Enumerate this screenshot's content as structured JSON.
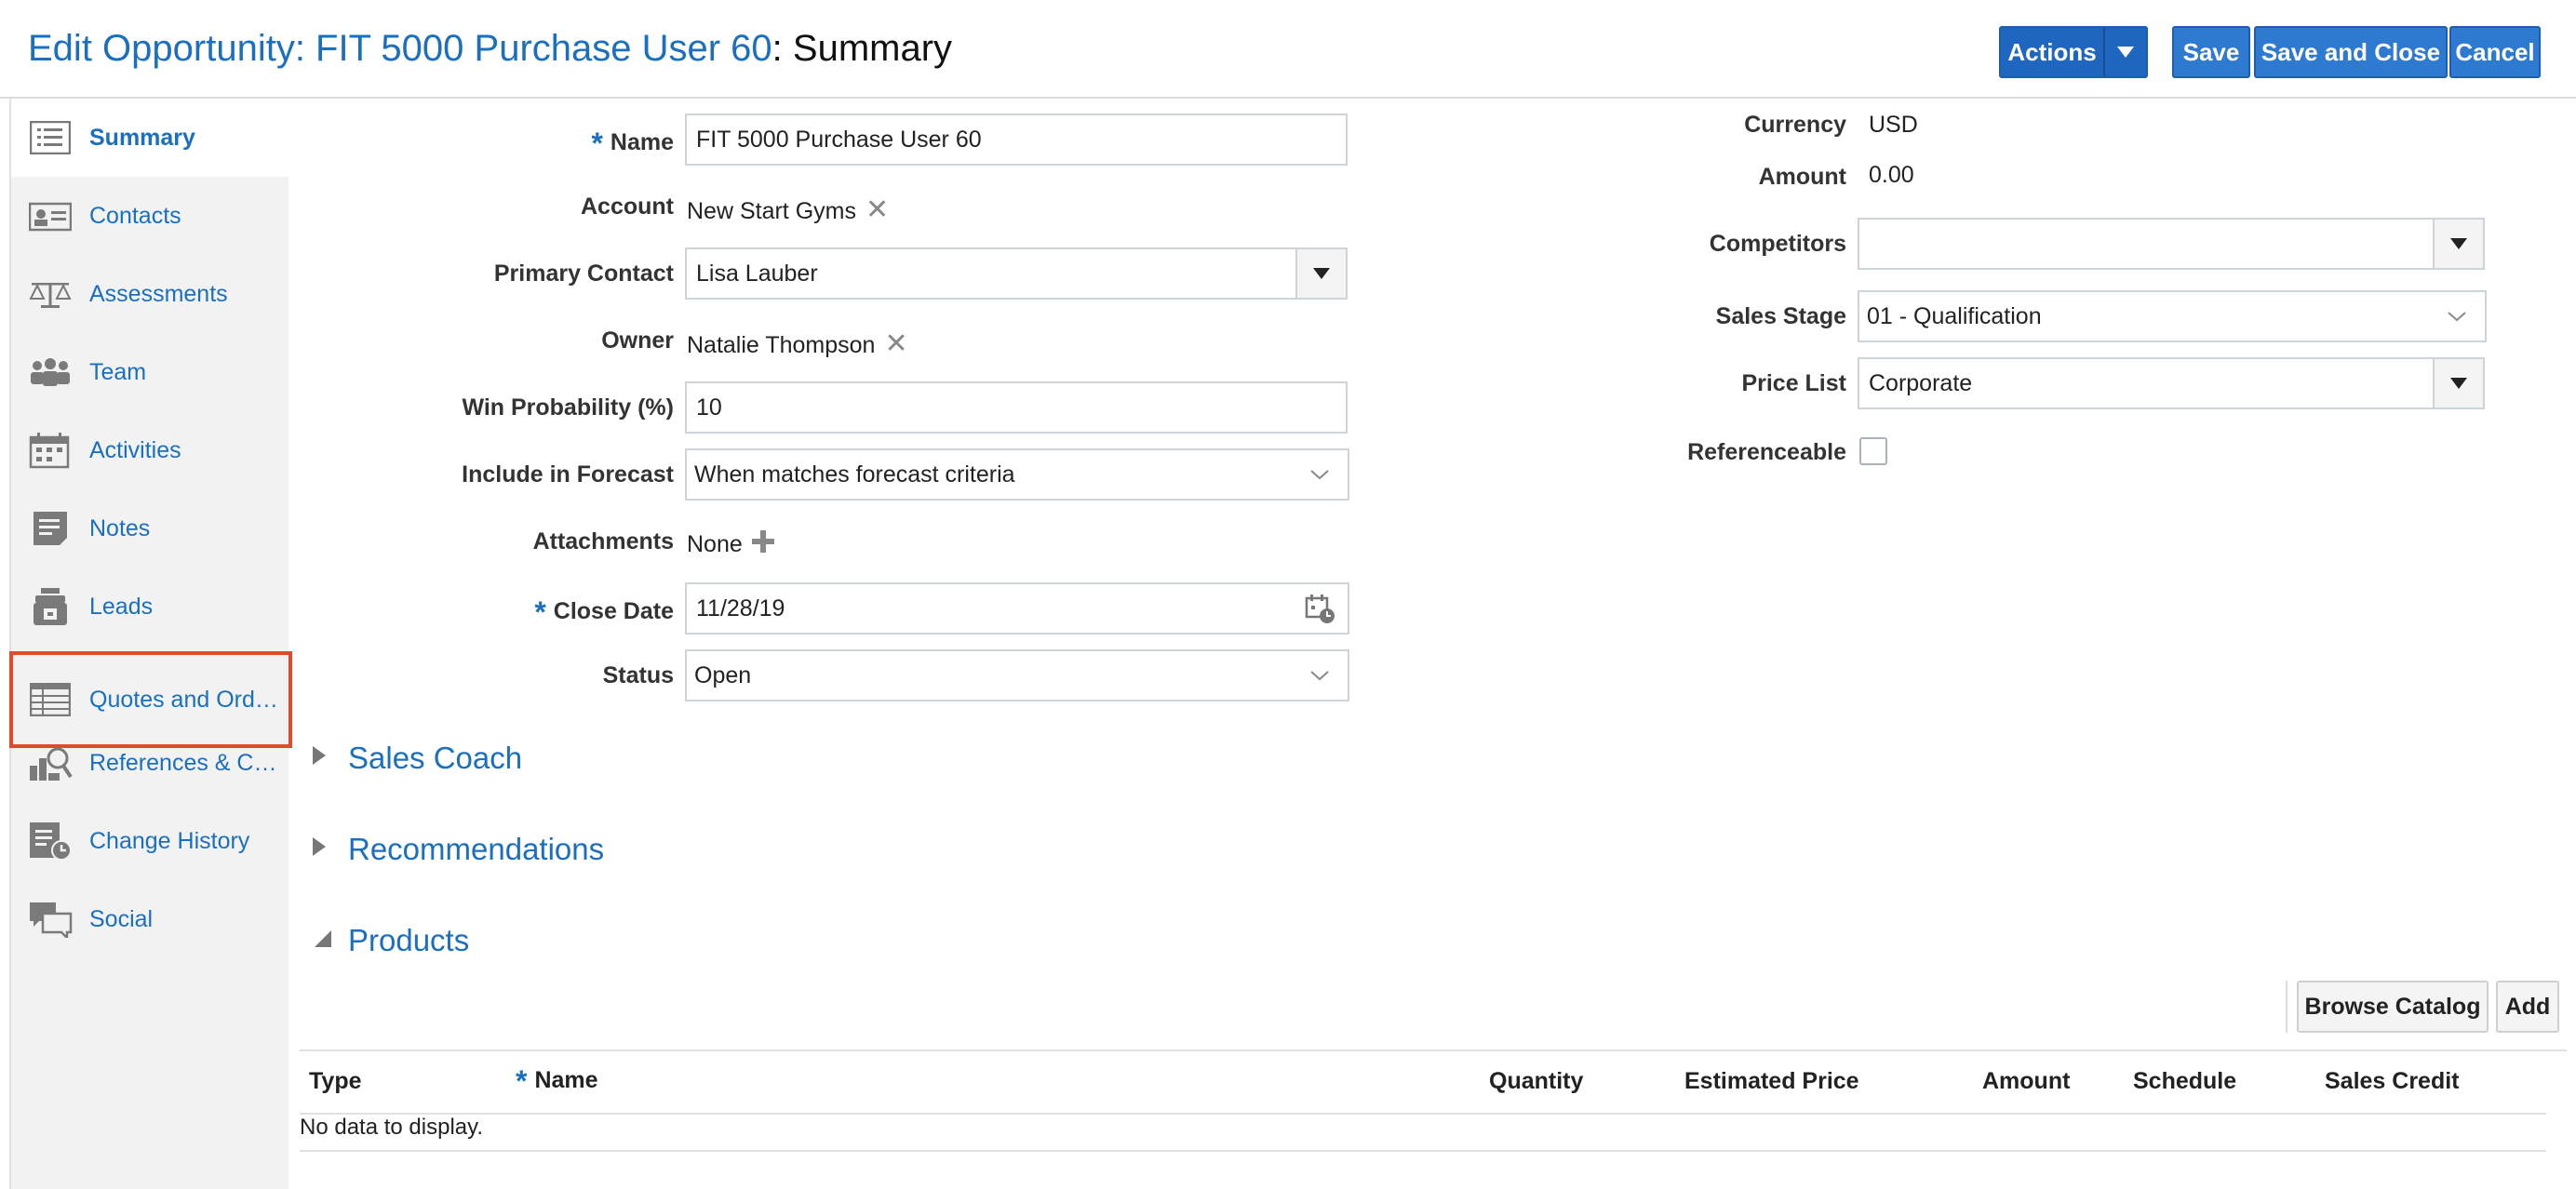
{
  "header": {
    "title_prefix": "Edit Opportunity: FIT 5000 Purchase User 60",
    "title_suffix": ": Summary",
    "actions_label": "Actions",
    "save_label": "Save",
    "save_close_label": "Save and Close",
    "cancel_label": "Cancel"
  },
  "sidebar": {
    "items": [
      {
        "label": "Summary",
        "icon": "summary-list-icon"
      },
      {
        "label": "Contacts",
        "icon": "contacts-card-icon"
      },
      {
        "label": "Assessments",
        "icon": "scales-icon"
      },
      {
        "label": "Team",
        "icon": "team-people-icon"
      },
      {
        "label": "Activities",
        "icon": "calendar-activities-icon"
      },
      {
        "label": "Notes",
        "icon": "notes-icon"
      },
      {
        "label": "Leads",
        "icon": "leads-icon"
      },
      {
        "label": "Quotes and Ord…",
        "icon": "quotes-grid-icon"
      },
      {
        "label": "References & C…",
        "icon": "references-search-icon"
      },
      {
        "label": "Change History",
        "icon": "change-history-icon"
      },
      {
        "label": "Social",
        "icon": "social-chat-icon"
      }
    ]
  },
  "form": {
    "name_label": "Name",
    "name_value": "FIT 5000 Purchase User 60",
    "account_label": "Account",
    "account_value": "New Start Gyms",
    "primary_contact_label": "Primary Contact",
    "primary_contact_value": "Lisa Lauber",
    "owner_label": "Owner",
    "owner_value": "Natalie Thompson",
    "win_prob_label": "Win Probability (%)",
    "win_prob_value": "10",
    "forecast_label": "Include in Forecast",
    "forecast_value": "When matches forecast criteria",
    "attachments_label": "Attachments",
    "attachments_value": "None",
    "close_date_label": "Close Date",
    "close_date_value": "11/28/19",
    "status_label": "Status",
    "status_value": "Open",
    "currency_label": "Currency",
    "currency_value": "USD",
    "amount_label": "Amount",
    "amount_value": "0.00",
    "competitors_label": "Competitors",
    "competitors_value": "",
    "sales_stage_label": "Sales Stage",
    "sales_stage_value": "01 - Qualification",
    "price_list_label": "Price List",
    "price_list_value": "Corporate",
    "referenceable_label": "Referenceable"
  },
  "sections": {
    "sales_coach": "Sales Coach",
    "recommendations": "Recommendations",
    "products": "Products"
  },
  "products": {
    "browse_catalog": "Browse Catalog",
    "add": "Add",
    "columns": [
      "Type",
      "Name",
      "Quantity",
      "Estimated Price",
      "Amount",
      "Schedule",
      "Sales Credit"
    ],
    "empty_text": "No data to display."
  },
  "colors": {
    "accent": "#1a6fc0",
    "button": "#2f7ad1",
    "highlight": "#e24a2e"
  }
}
